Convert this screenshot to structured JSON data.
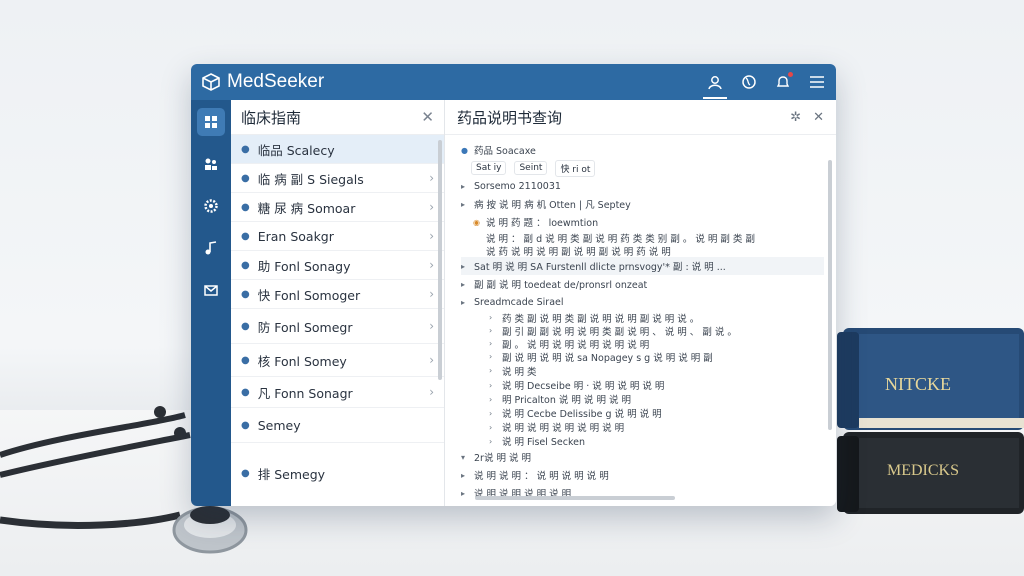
{
  "app": {
    "title": "MedSeeker"
  },
  "list_pane": {
    "title": "临床指南",
    "items": [
      {
        "label": "临品 Scalecy"
      },
      {
        "label": "临 病 副 S Siegals"
      },
      {
        "label": "糖 尿 病 Somoar"
      },
      {
        "label": "Eran Soakgr"
      },
      {
        "label": "助 Fonl Sonagy"
      },
      {
        "label": "快 Fonl Somoger"
      },
      {
        "label": "防 Fonl Somegr"
      },
      {
        "label": "核 Fonl Somey"
      },
      {
        "label": "凡 Fonn Sonagr"
      },
      {
        "label": "Semey"
      },
      {
        "label": "排 Semegy"
      }
    ]
  },
  "detail": {
    "title": "药品说明书查询",
    "root_label": "药品 Soacaxe",
    "filters": [
      "Sat iy",
      "Seint",
      "快 ri ot"
    ],
    "rows": [
      {
        "text": "Sorsemo 2110031"
      },
      {
        "text": "病 按 说 明 病 机 Otten   |   凡   Septey"
      },
      {
        "text": "说 明 药 题 ： loewmtion"
      },
      {
        "text": "说 明 ： 副 d   说 明 类 副 说 明 药 类 类 别 副 。 说 明 副 类 副"
      },
      {
        "text": "说 药 说 明 说 明 副 说 明 副 说 明 药 说 明"
      },
      {
        "text": "Sat 明 说 明 SA Furstenll dlicte prnsvogy'* 副 : 说 明 ..."
      },
      {
        "text": "副 副 说 明   toedeat de/pronsrl onzeat"
      },
      {
        "text": "Sreadmcade Sirael"
      },
      {
        "text": "药 类 副 说 明 类 副 说 明 说 明 副 说 明 说 。"
      },
      {
        "text": "副 引 副 副 说 明 说 明 类 副 说 明 、 说 明 、 副 说 。"
      },
      {
        "text": "副 。 说 明 说 明 说 明 说 明 说 明"
      },
      {
        "text": "副 说 明 说 明 说 sa Nopagey s g 说 明 说 明 副"
      },
      {
        "text": "说 明 类"
      },
      {
        "text": "说 明 Decseibe 明 · 说 明 说 明 说 明"
      },
      {
        "text": "明 Pricalton 说 明 说 明 说 明"
      },
      {
        "text": "说 明 Cecbe Delissibe g 说 明 说 明"
      },
      {
        "text": "说 明 说 明 说 明 说 明 说 明"
      },
      {
        "text": "说 明 Fisel Secken"
      },
      {
        "text": "2r说 明 说 明"
      },
      {
        "text": "说 明 说 明 ： 说 明 说 明 说 明"
      },
      {
        "text": "说 明 说 明 说 明 说 明"
      }
    ]
  },
  "books": {
    "top": "NITCKE",
    "bottom": "MEDICKS"
  },
  "colors": {
    "titlebar": "#2d6aa3",
    "rail": "#23588c",
    "accent": "#3c78b8"
  }
}
